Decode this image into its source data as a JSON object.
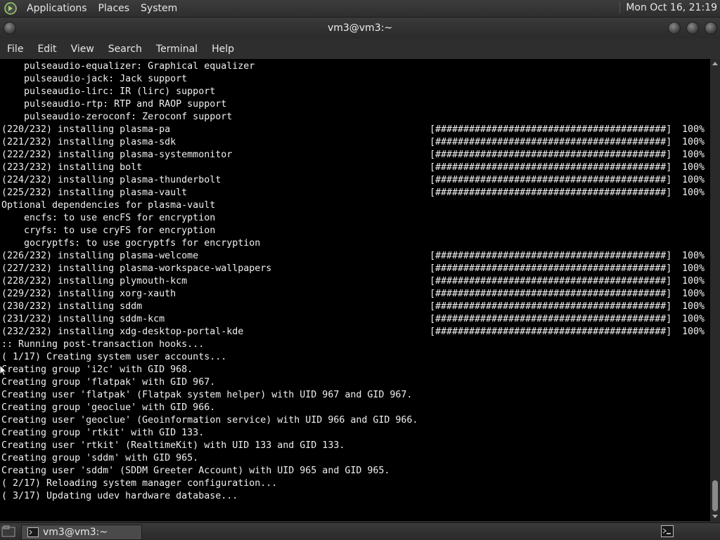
{
  "top_panel": {
    "menus": [
      "Applications",
      "Places",
      "System"
    ],
    "clock": "Mon Oct 16, 21:19"
  },
  "window": {
    "title": "vm3@vm3:~"
  },
  "menubar": {
    "items": [
      "File",
      "Edit",
      "View",
      "Search",
      "Terminal",
      "Help"
    ]
  },
  "terminal": {
    "lines": [
      {
        "text": "    pulseaudio-equalizer: Graphical equalizer"
      },
      {
        "text": "    pulseaudio-jack: Jack support"
      },
      {
        "text": "    pulseaudio-lirc: IR (lirc) support"
      },
      {
        "text": "    pulseaudio-rtp: RTP and RAOP support"
      },
      {
        "text": "    pulseaudio-zeroconf: Zeroconf support"
      },
      {
        "text": "(220/232) installing plasma-pa",
        "bar": "[#########################################]",
        "pct": "100%"
      },
      {
        "text": "(221/232) installing plasma-sdk",
        "bar": "[#########################################]",
        "pct": "100%"
      },
      {
        "text": "(222/232) installing plasma-systemmonitor",
        "bar": "[#########################################]",
        "pct": "100%"
      },
      {
        "text": "(223/232) installing bolt",
        "bar": "[#########################################]",
        "pct": "100%"
      },
      {
        "text": "(224/232) installing plasma-thunderbolt",
        "bar": "[#########################################]",
        "pct": "100%"
      },
      {
        "text": "(225/232) installing plasma-vault",
        "bar": "[#########################################]",
        "pct": "100%"
      },
      {
        "text": "Optional dependencies for plasma-vault"
      },
      {
        "text": "    encfs: to use encFS for encryption"
      },
      {
        "text": "    cryfs: to use cryFS for encryption"
      },
      {
        "text": "    gocryptfs: to use gocryptfs for encryption"
      },
      {
        "text": "(226/232) installing plasma-welcome",
        "bar": "[#########################################]",
        "pct": "100%"
      },
      {
        "text": "(227/232) installing plasma-workspace-wallpapers",
        "bar": "[#########################################]",
        "pct": "100%"
      },
      {
        "text": "(228/232) installing plymouth-kcm",
        "bar": "[#########################################]",
        "pct": "100%"
      },
      {
        "text": "(229/232) installing xorg-xauth",
        "bar": "[#########################################]",
        "pct": "100%"
      },
      {
        "text": "(230/232) installing sddm",
        "bar": "[#########################################]",
        "pct": "100%"
      },
      {
        "text": "(231/232) installing sddm-kcm",
        "bar": "[#########################################]",
        "pct": "100%"
      },
      {
        "text": "(232/232) installing xdg-desktop-portal-kde",
        "bar": "[#########################################]",
        "pct": "100%"
      },
      {
        "text": ":: Running post-transaction hooks..."
      },
      {
        "text": "( 1/17) Creating system user accounts..."
      },
      {
        "text": "Creating group 'i2c' with GID 968."
      },
      {
        "text": "Creating group 'flatpak' with GID 967."
      },
      {
        "text": "Creating user 'flatpak' (Flatpak system helper) with UID 967 and GID 967."
      },
      {
        "text": "Creating group 'geoclue' with GID 966."
      },
      {
        "text": "Creating user 'geoclue' (Geoinformation service) with UID 966 and GID 966."
      },
      {
        "text": "Creating group 'rtkit' with GID 133."
      },
      {
        "text": "Creating user 'rtkit' (RealtimeKit) with UID 133 and GID 133."
      },
      {
        "text": "Creating group 'sddm' with GID 965."
      },
      {
        "text": "Creating user 'sddm' (SDDM Greeter Account) with UID 965 and GID 965."
      },
      {
        "text": "( 2/17) Reloading system manager configuration..."
      },
      {
        "text": "( 3/17) Updating udev hardware database..."
      }
    ]
  },
  "taskbar": {
    "task_label": "vm3@vm3:~"
  },
  "icons": {
    "panel_logo": "gnome-foot-icon",
    "show_desktop": "show-desktop-icon",
    "task_icon": "terminal-icon",
    "tray": "terminal-tray-icon"
  }
}
